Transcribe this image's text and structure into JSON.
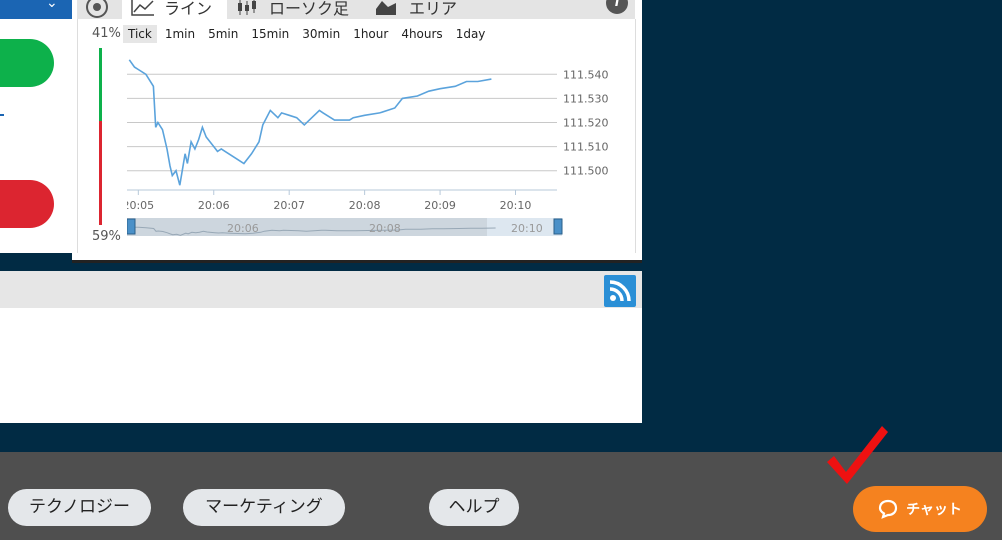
{
  "chart_tabs": {
    "line_label": "ライン",
    "candle_label": "ローソク足",
    "area_label": "エリア"
  },
  "sentiment": {
    "top_pct": "41%",
    "bottom_pct": "59%",
    "top_value": 41,
    "bottom_value": 59,
    "colors": {
      "buy": "#0db14b",
      "sell": "#dc2530"
    }
  },
  "timeframes": [
    {
      "label": "Tick",
      "active": true
    },
    {
      "label": "1min",
      "active": false
    },
    {
      "label": "5min",
      "active": false
    },
    {
      "label": "15min",
      "active": false
    },
    {
      "label": "30min",
      "active": false
    },
    {
      "label": "1hour",
      "active": false
    },
    {
      "label": "4hours",
      "active": false
    },
    {
      "label": "1day",
      "active": false
    }
  ],
  "chart_data": {
    "type": "line",
    "series_color": "#5ba3dc",
    "y_ticks": [
      "111.540",
      "111.530",
      "111.520",
      "111.510",
      "111.500"
    ],
    "ylim": [
      111.492,
      111.548
    ],
    "x_ticks": [
      "20:05",
      "20:06",
      "20:07",
      "20:08",
      "20:09",
      "20:10"
    ],
    "navigator_ticks": [
      "20:06",
      "20:08",
      "20:10"
    ],
    "x": [
      4.88,
      4.95,
      5.0,
      5.1,
      5.2,
      5.23,
      5.26,
      5.32,
      5.38,
      5.42,
      5.45,
      5.5,
      5.55,
      5.62,
      5.65,
      5.7,
      5.75,
      5.8,
      5.85,
      5.9,
      6.0,
      6.05,
      6.1,
      6.15,
      6.2,
      6.3,
      6.4,
      6.5,
      6.6,
      6.65,
      6.75,
      6.85,
      6.9,
      7.0,
      7.1,
      7.2,
      7.3,
      7.4,
      7.45,
      7.6,
      7.7,
      7.8,
      7.85,
      8.0,
      8.2,
      8.4,
      8.5,
      8.7,
      8.85,
      9.0,
      9.2,
      9.35,
      9.5,
      9.68
    ],
    "y": [
      111.546,
      111.543,
      111.542,
      111.54,
      111.535,
      111.518,
      111.52,
      111.517,
      111.509,
      111.502,
      111.498,
      111.5,
      111.494,
      111.507,
      111.503,
      111.512,
      111.509,
      111.513,
      111.518,
      111.514,
      111.51,
      111.508,
      111.509,
      111.508,
      111.507,
      111.505,
      111.503,
      111.507,
      111.512,
      111.519,
      111.525,
      111.522,
      111.524,
      111.523,
      111.522,
      111.519,
      111.522,
      111.525,
      111.524,
      111.521,
      111.521,
      111.521,
      111.522,
      111.523,
      111.524,
      111.526,
      111.53,
      111.531,
      111.533,
      111.534,
      111.535,
      111.537,
      111.537,
      111.538
    ]
  },
  "footer": {
    "pill_tech": "テクノロジー",
    "pill_marketing": "マーケティング",
    "pill_help": "ヘルプ",
    "chat_label": "チャット"
  },
  "icons": {
    "settings": "settings-icon",
    "line": "line-chart-icon",
    "candle": "candlestick-icon",
    "area": "area-chart-icon",
    "info": "info-icon",
    "rss": "rss-icon",
    "chat": "chat-bubble-icon",
    "check": "checkmark-icon"
  },
  "colors": {
    "background": "#012b44",
    "footer": "#4f4f4f",
    "chat_button": "#f5821f",
    "accent_blue": "#1b65b3",
    "rss": "#2a8fd6"
  }
}
